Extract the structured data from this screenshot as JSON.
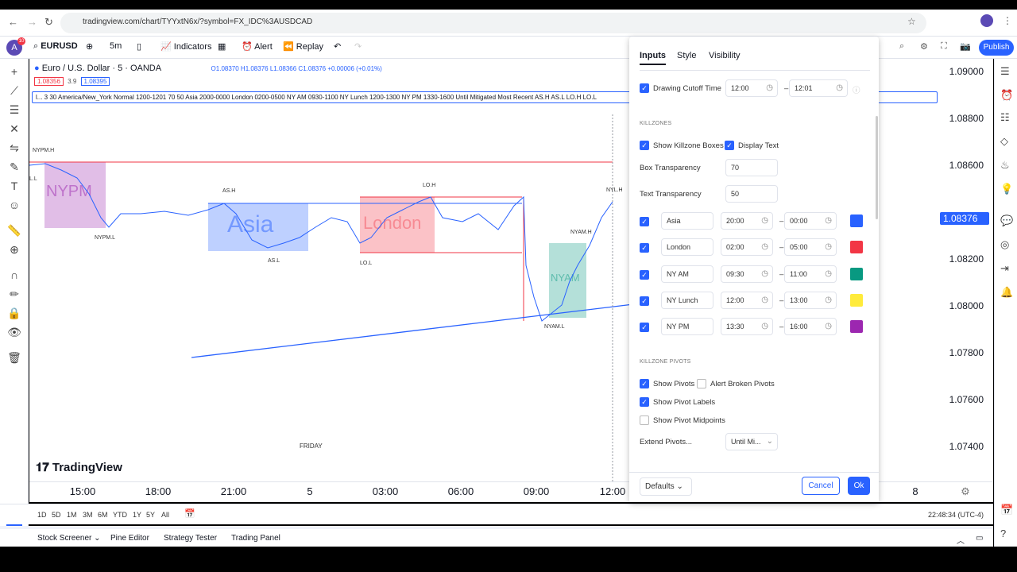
{
  "browser": {
    "url": "tradingview.com/chart/TYYxtN6x/?symbol=FX_IDC%3AUSDCAD"
  },
  "toolbar": {
    "avatar": "A",
    "notif": "10",
    "symbol": "EURUSD",
    "interval": "5m",
    "indicators": "Indicators",
    "alert": "Alert",
    "replay": "Replay",
    "publish": "Publish"
  },
  "legend": {
    "title": "Euro / U.S. Dollar · 5 · OANDA",
    "ohlc": "O1.08370 H1.08376 L1.08366 C1.08376 +0.00006 (+0.01%)",
    "bid": "1.08356",
    "spread": "3.9",
    "ask": "1.08395",
    "indicator": "l... 3 30 America/New_York Normal 1200-1201 70 50 Asia 2000-0000 London 0200-0500 NY AM 0930-1100 NY Lunch 1200-1300 NY PM 1330-1600 Until Mitigated Most Recent AS.H AS.L LO.H LO.L"
  },
  "chart": {
    "zones": [
      "NYPM",
      "Asia",
      "London",
      "NYAM"
    ],
    "pivots": [
      "NYPM.H",
      "NYPM.L",
      "AS.H",
      "AS.L",
      "LO.H",
      "LO.L",
      "NYAM.H",
      "NYAM.L",
      "NYL.H",
      "L.L"
    ],
    "day_label": "FRIDAY",
    "logo": "TradingView"
  },
  "price_axis": {
    "ticks": [
      "1.09000",
      "1.08800",
      "1.08600",
      "1.08200",
      "1.08000",
      "1.07800",
      "1.07600",
      "1.07400"
    ],
    "current": "1.08376"
  },
  "time_axis": {
    "ticks": [
      "15:00",
      "18:00",
      "21:00",
      "5",
      "03:00",
      "06:00",
      "09:00",
      "12:00",
      "8"
    ]
  },
  "ranges": [
    "1D",
    "5D",
    "1M",
    "3M",
    "6M",
    "YTD",
    "1Y",
    "5Y",
    "All"
  ],
  "clock": "22:48:34 (UTC-4)",
  "bottom_panel": [
    "Stock Screener",
    "Pine Editor",
    "Strategy Tester",
    "Trading Panel"
  ],
  "dialog": {
    "tabs": [
      "Inputs",
      "Style",
      "Visibility"
    ],
    "cutoff": {
      "label": "Drawing Cutoff Time",
      "checked": true,
      "start": "12:00",
      "end": "12:01"
    },
    "killzones_header": "KILLZONES",
    "show_boxes": {
      "label": "Show Killzone Boxes",
      "checked": true
    },
    "display_text": {
      "label": "Display Text",
      "checked": true
    },
    "box_transparency": {
      "label": "Box Transparency",
      "value": "70"
    },
    "text_transparency": {
      "label": "Text Transparency",
      "value": "50"
    },
    "sessions": [
      {
        "name": "Asia",
        "start": "20:00",
        "end": "00:00",
        "color": "#2962ff",
        "checked": true
      },
      {
        "name": "London",
        "start": "02:00",
        "end": "05:00",
        "color": "#f23645",
        "checked": true
      },
      {
        "name": "NY AM",
        "start": "09:30",
        "end": "11:00",
        "color": "#089981",
        "checked": true
      },
      {
        "name": "NY Lunch",
        "start": "12:00",
        "end": "13:00",
        "color": "#ffeb3b",
        "checked": true
      },
      {
        "name": "NY PM",
        "start": "13:30",
        "end": "16:00",
        "color": "#9c27b0",
        "checked": true
      }
    ],
    "pivots_header": "KILLZONE PIVOTS",
    "show_pivots": {
      "label": "Show Pivots",
      "checked": true
    },
    "alert_broken": {
      "label": "Alert Broken Pivots",
      "checked": false
    },
    "pivot_labels": {
      "label": "Show Pivot Labels",
      "checked": true
    },
    "pivot_midpoints": {
      "label": "Show Pivot Midpoints",
      "checked": false
    },
    "extend_pivots": {
      "label": "Extend Pivots...",
      "value": "Until Mi..."
    },
    "defaults": "Defaults",
    "cancel": "Cancel",
    "ok": "Ok"
  },
  "colors": {
    "accent": "#2962ff",
    "current_price": "#2962ff"
  }
}
